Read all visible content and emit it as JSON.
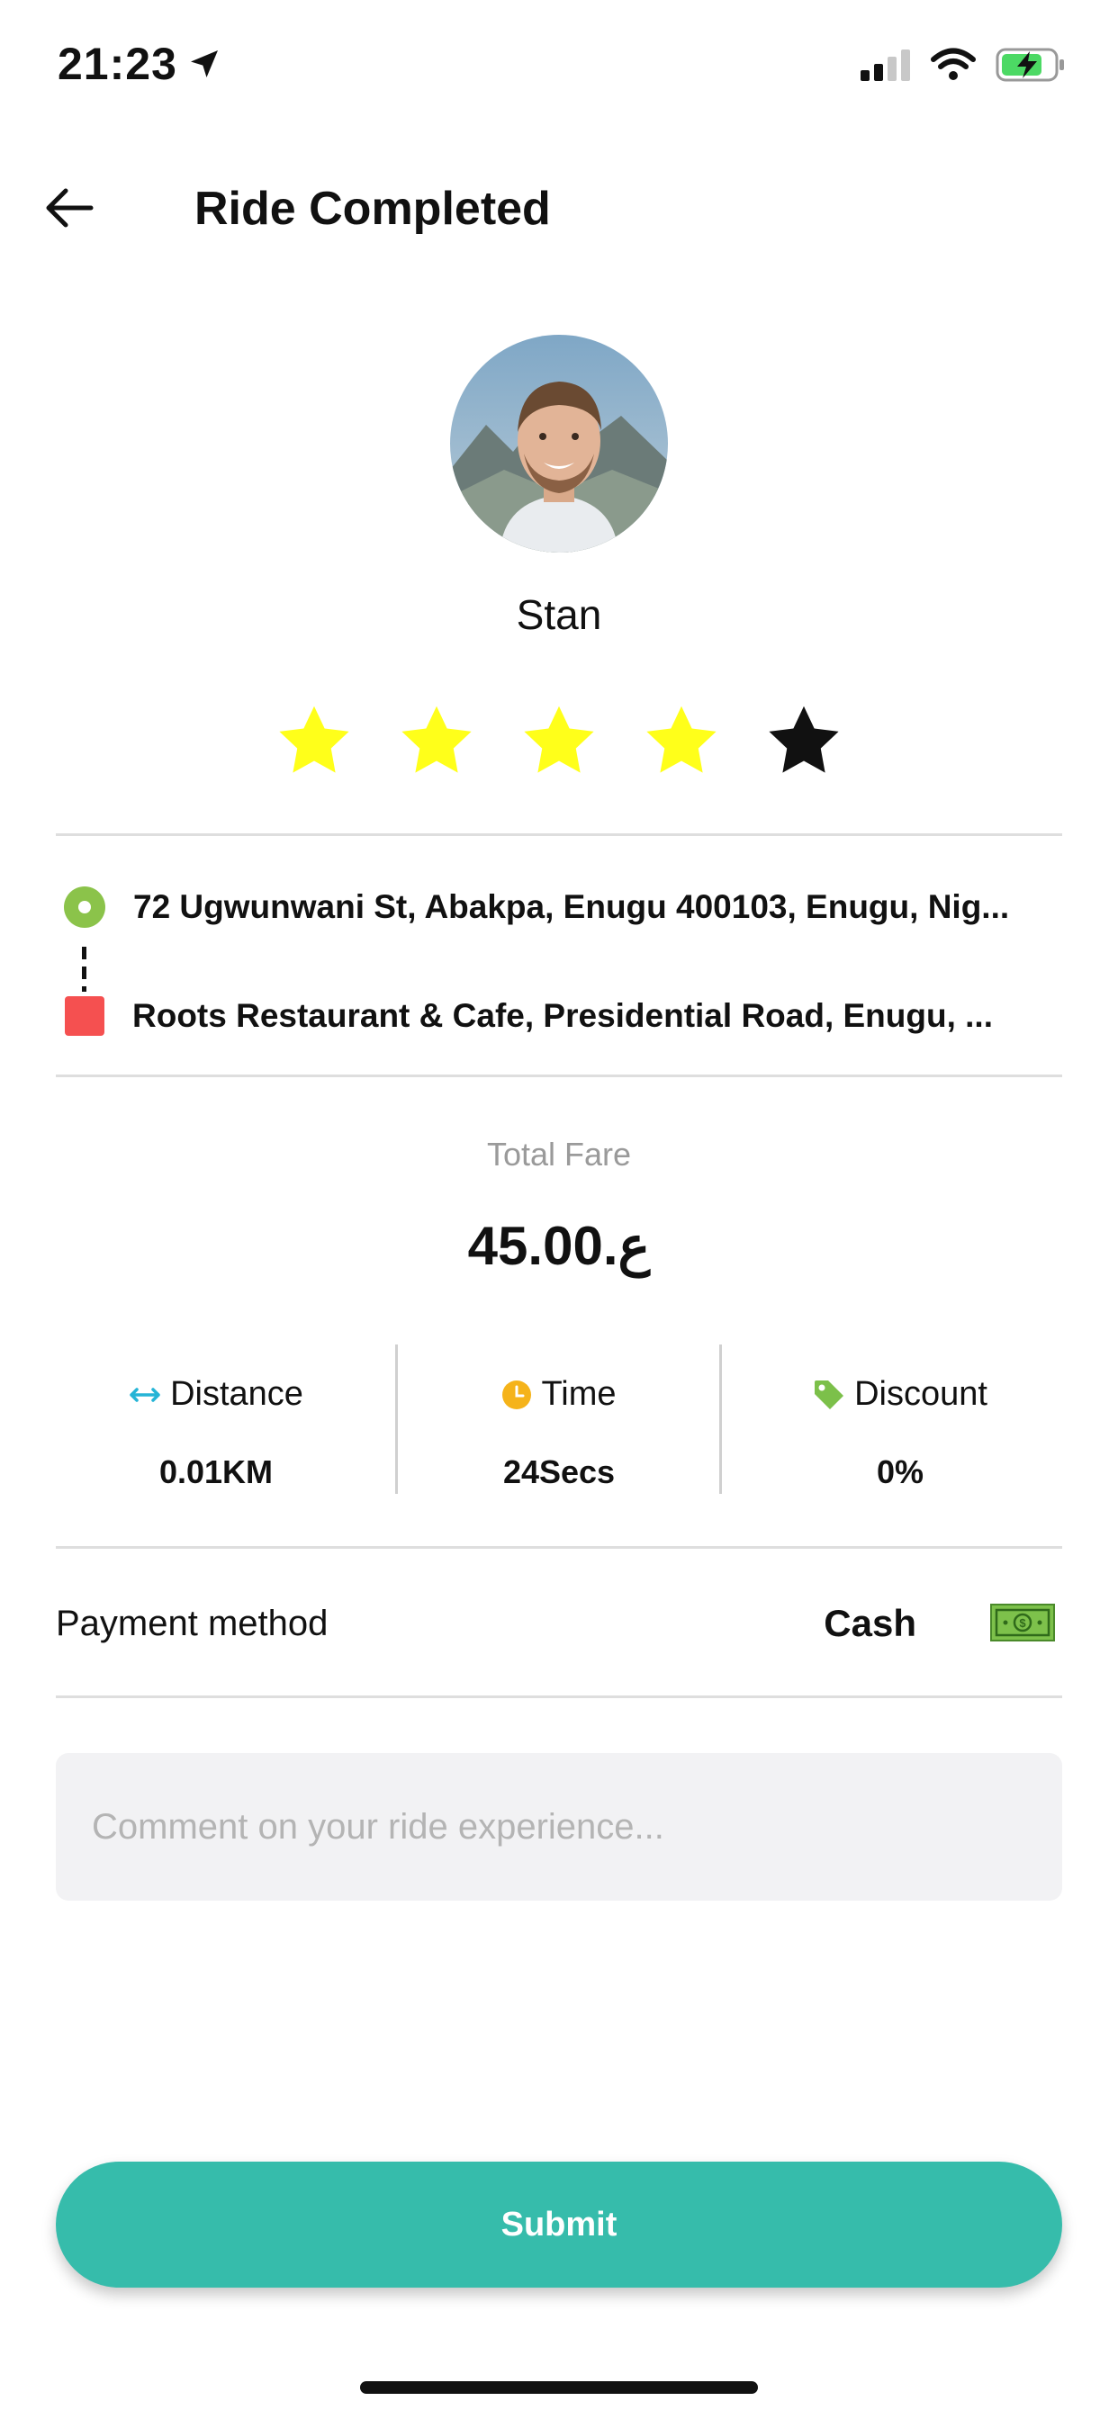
{
  "status_bar": {
    "time": "21:23"
  },
  "header": {
    "title": "Ride Completed"
  },
  "driver": {
    "name": "Stan",
    "rating": 4,
    "rating_max": 5
  },
  "route": {
    "pickup": "72 Ugwunwani St, Abakpa, Enugu 400103, Enugu, Nig...",
    "dropoff": "Roots Restaurant & Cafe, Presidential Road, Enugu, ..."
  },
  "fare": {
    "label": "Total Fare",
    "value": "45.00.ع"
  },
  "stats": [
    {
      "label": "Distance",
      "value": "0.01KM",
      "icon": "distance-arrows-icon"
    },
    {
      "label": "Time",
      "value": "24Secs",
      "icon": "clock-icon"
    },
    {
      "label": "Discount",
      "value": "0%",
      "icon": "tag-icon"
    }
  ],
  "payment": {
    "label": "Payment method",
    "value": "Cash",
    "icon": "cash-icon"
  },
  "comment": {
    "placeholder": "Comment on your ride experience...",
    "value": ""
  },
  "submit": {
    "label": "Submit"
  },
  "colors": {
    "accent": "#36bcab",
    "star_filled": "#ffff1a",
    "pickup_marker": "#8bc34a",
    "dropoff_marker": "#f55050",
    "distance_icon": "#25b4d6",
    "clock_icon": "#f5b31a",
    "tag_icon": "#7cc04a"
  }
}
